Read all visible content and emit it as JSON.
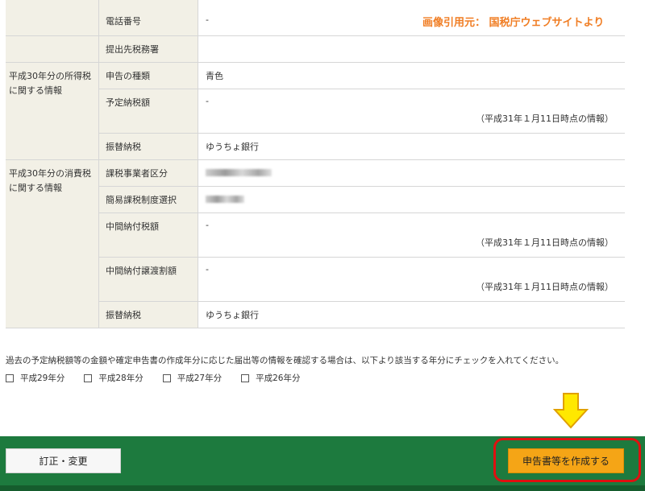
{
  "source_label": "画像引用元： 国税庁ウェブサイトより",
  "rows": {
    "phone": {
      "label": "電話番号",
      "value": "-"
    },
    "office": {
      "label": "提出先税務署",
      "value": ""
    },
    "income_group": "平成30年分の所得税に関する情報",
    "filing_type": {
      "label": "申告の種類",
      "value": "青色"
    },
    "prepaid_tax": {
      "label": "予定納税額",
      "value": "-",
      "note": "（平成31年１月11日時点の情報）"
    },
    "transfer1": {
      "label": "振替納税",
      "value": "ゆうちょ銀行"
    },
    "consumption_group": "平成30年分の消費税に関する情報",
    "business_class": {
      "label": "課税事業者区分"
    },
    "simplified": {
      "label": "簡易課税制度選択"
    },
    "interim_tax": {
      "label": "中間納付税額",
      "value": "-",
      "note": "（平成31年１月11日時点の情報）"
    },
    "interim_transfer": {
      "label": "中間納付譲渡割額",
      "value": "-",
      "note": "（平成31年１月11日時点の情報）"
    },
    "transfer2": {
      "label": "振替納税",
      "value": "ゆうちょ銀行"
    }
  },
  "instruction": "過去の予定納税額等の金額や確定申告書の作成年分に応じた届出等の情報を確認する場合は、以下より該当する年分にチェックを入れてください。",
  "years": [
    "平成29年分",
    "平成28年分",
    "平成27年分",
    "平成26年分"
  ],
  "buttons": {
    "edit": "訂正・変更",
    "create": "申告書等を作成する"
  },
  "colors": {
    "footer": "#1d7a3e",
    "create_button": "#f5a516",
    "highlight": "#e01010",
    "arrow": "#ffe800"
  }
}
